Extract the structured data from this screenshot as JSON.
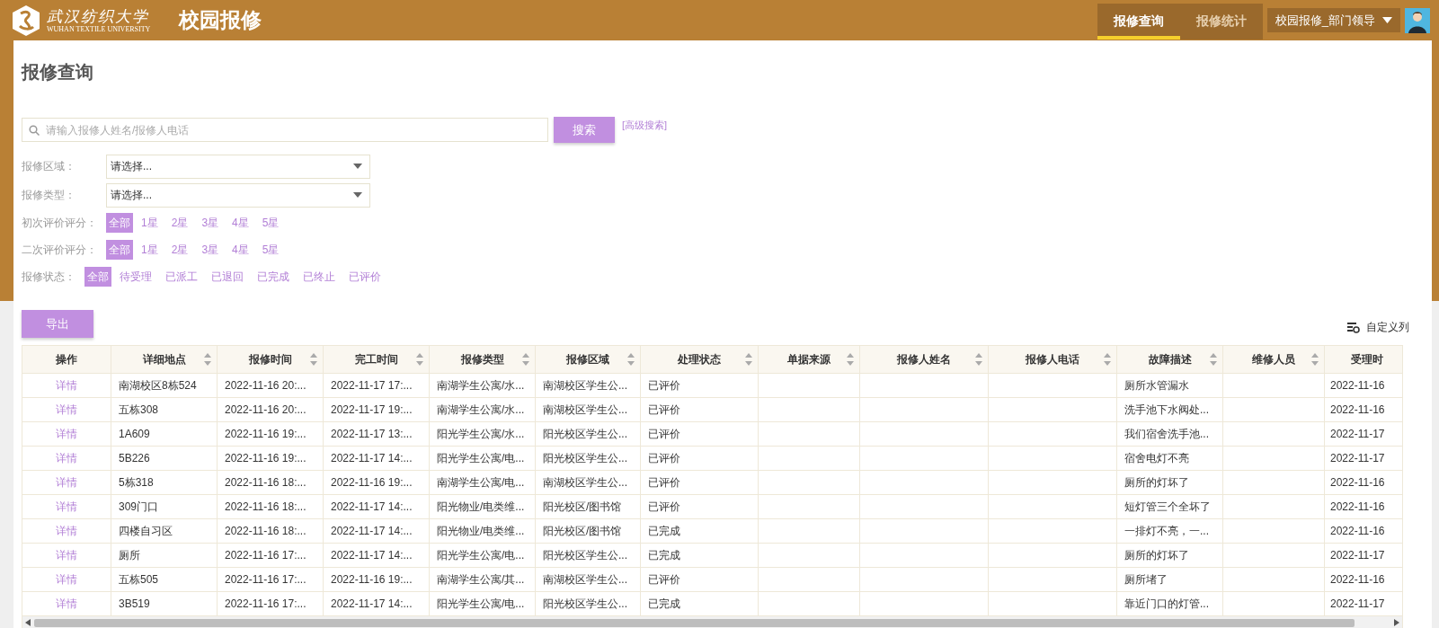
{
  "header": {
    "logo_cn": "武汉纺织大学",
    "logo_en": "WUHAN TEXTILE UNIVERSITY",
    "app_title": "校园报修",
    "tabs": [
      {
        "label": "报修查询",
        "selected": true
      },
      {
        "label": "报修统计",
        "selected": false
      }
    ],
    "user": "校园报修_部门领导"
  },
  "page_title": "报修查询",
  "search": {
    "placeholder": "请输入报修人姓名/报修人电话",
    "button": "搜索",
    "advanced_link": "[高级搜索]"
  },
  "selects": [
    {
      "label": "报修区域：",
      "value": "请选择..."
    },
    {
      "label": "报修类型：",
      "value": "请选择..."
    }
  ],
  "filters": [
    {
      "label": "初次评价评分：",
      "options": [
        {
          "label": "全部",
          "selected": true
        },
        {
          "label": "1星",
          "selected": false
        },
        {
          "label": "2星",
          "selected": false
        },
        {
          "label": "3星",
          "selected": false
        },
        {
          "label": "4星",
          "selected": false
        },
        {
          "label": "5星",
          "selected": false
        }
      ]
    },
    {
      "label": "二次评价评分：",
      "options": [
        {
          "label": "全部",
          "selected": true
        },
        {
          "label": "1星",
          "selected": false
        },
        {
          "label": "2星",
          "selected": false
        },
        {
          "label": "3星",
          "selected": false
        },
        {
          "label": "4星",
          "selected": false
        },
        {
          "label": "5星",
          "selected": false
        }
      ]
    },
    {
      "label": "报修状态：",
      "options": [
        {
          "label": "全部",
          "selected": true
        },
        {
          "label": "待受理",
          "selected": false
        },
        {
          "label": "已派工",
          "selected": false
        },
        {
          "label": "已退回",
          "selected": false
        },
        {
          "label": "已完成",
          "selected": false
        },
        {
          "label": "已终止",
          "selected": false
        },
        {
          "label": "已评价",
          "selected": false
        }
      ]
    }
  ],
  "export_button": "导出",
  "customize_columns": "自定义列",
  "table": {
    "columns": [
      {
        "label": "操作",
        "sortable": false
      },
      {
        "label": "详细地点",
        "sortable": true
      },
      {
        "label": "报修时间",
        "sortable": true
      },
      {
        "label": "完工时间",
        "sortable": true
      },
      {
        "label": "报修类型",
        "sortable": true
      },
      {
        "label": "报修区域",
        "sortable": true
      },
      {
        "label": "处理状态",
        "sortable": true
      },
      {
        "label": "单据来源",
        "sortable": true
      },
      {
        "label": "报修人姓名",
        "sortable": true
      },
      {
        "label": "报修人电话",
        "sortable": true
      },
      {
        "label": "故障描述",
        "sortable": true
      },
      {
        "label": "维修人员",
        "sortable": true
      },
      {
        "label": "受理时",
        "sortable": false
      }
    ],
    "rows": [
      {
        "cells": [
          "详情",
          "南湖校区8栋524",
          "2022-11-16 20:...",
          "2022-11-17 17:...",
          "南湖学生公寓/水...",
          "南湖校区学生公...",
          "已评价",
          null,
          null,
          null,
          "厕所水管漏水",
          null,
          "2022-11-16"
        ]
      },
      {
        "cells": [
          "详情",
          "五栋308",
          "2022-11-16 20:...",
          "2022-11-17 19:...",
          "南湖学生公寓/水...",
          "南湖校区学生公...",
          "已评价",
          null,
          null,
          null,
          "洗手池下水阀处...",
          null,
          "2022-11-16"
        ]
      },
      {
        "cells": [
          "详情",
          "1A609",
          "2022-11-16 19:...",
          "2022-11-17 13:...",
          "阳光学生公寓/水...",
          "阳光校区学生公...",
          "已评价",
          null,
          null,
          null,
          "我们宿舍洗手池...",
          null,
          "2022-11-17"
        ]
      },
      {
        "cells": [
          "详情",
          "5B226",
          "2022-11-16 19:...",
          "2022-11-17 14:...",
          "阳光学生公寓/电...",
          "阳光校区学生公...",
          "已评价",
          null,
          null,
          null,
          "宿舍电灯不亮",
          null,
          "2022-11-17"
        ]
      },
      {
        "cells": [
          "详情",
          "5栋318",
          "2022-11-16 18:...",
          "2022-11-16 19:...",
          "南湖学生公寓/电...",
          "南湖校区学生公...",
          "已评价",
          null,
          null,
          null,
          "厕所的灯坏了",
          null,
          "2022-11-16"
        ]
      },
      {
        "cells": [
          "详情",
          "309门口",
          "2022-11-16 18:...",
          "2022-11-17 14:...",
          "阳光物业/电类维...",
          "阳光校区/图书馆",
          "已评价",
          null,
          null,
          null,
          "短灯管三个全坏了",
          null,
          "2022-11-16"
        ]
      },
      {
        "cells": [
          "详情",
          "四楼自习区",
          "2022-11-16 18:...",
          "2022-11-17 14:...",
          "阳光物业/电类维...",
          "阳光校区/图书馆",
          "已完成",
          null,
          null,
          null,
          "一排灯不亮，一...",
          null,
          "2022-11-16"
        ]
      },
      {
        "cells": [
          "详情",
          "厕所",
          "2022-11-16 17:...",
          "2022-11-17 14:...",
          "阳光学生公寓/电...",
          "阳光校区学生公...",
          "已完成",
          null,
          null,
          null,
          "厕所的灯坏了",
          null,
          "2022-11-17"
        ]
      },
      {
        "cells": [
          "详情",
          "五栋505",
          "2022-11-16 17:...",
          "2022-11-16 19:...",
          "南湖学生公寓/其...",
          "南湖校区学生公...",
          "已评价",
          null,
          null,
          null,
          "厕所堵了",
          null,
          "2022-11-16"
        ]
      },
      {
        "cells": [
          "详情",
          "3B519",
          "2022-11-16 17:...",
          "2022-11-17 14:...",
          "阳光学生公寓/电...",
          "阳光校区学生公...",
          "已完成",
          null,
          null,
          null,
          "靠近门口的灯管...",
          null,
          "2022-11-17"
        ]
      }
    ]
  }
}
